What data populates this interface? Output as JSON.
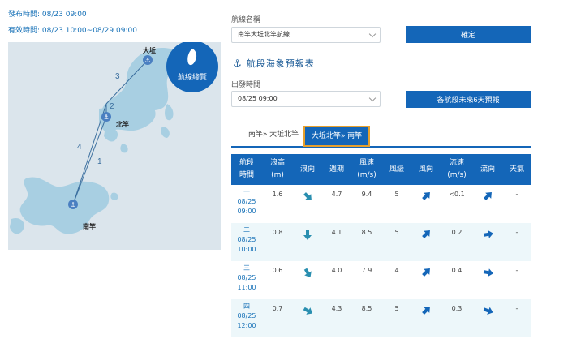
{
  "header": {
    "publish_label": "發布時間:",
    "publish_time": "08/23 09:00",
    "valid_label": "有效時間:",
    "valid_time": "08/23 10:00~08/29 09:00"
  },
  "map": {
    "overview_label": "航線總覽",
    "ports": {
      "north": "大坵",
      "mid": "北竿",
      "south": "南竿"
    },
    "route_numbers": [
      "1",
      "2",
      "3",
      "4"
    ]
  },
  "form": {
    "route_label": "航線名稱",
    "route_value": "南竿大坵北竿航線",
    "confirm_label": "確定",
    "section_title": "航段海象預報表",
    "depart_label": "出發時間",
    "depart_value": "08/25 09:00",
    "six_day_label": "各航段未來6天預報"
  },
  "tabs": [
    {
      "label": "南竿» 大坵北竿",
      "active": false
    },
    {
      "label": "大坵北竿» 南竿",
      "active": true
    }
  ],
  "table": {
    "headers": [
      [
        "航段",
        "時間"
      ],
      [
        "浪高",
        "(m)"
      ],
      [
        "浪向"
      ],
      [
        "週期"
      ],
      [
        "風速",
        "(m/s)"
      ],
      [
        "風級"
      ],
      [
        "風向"
      ],
      [
        "流速",
        "(m/s)"
      ],
      [
        "流向"
      ],
      [
        "天氣"
      ]
    ],
    "rows": [
      {
        "segment": "一",
        "date": "08/25",
        "time": "09:00",
        "wave_height": "1.6",
        "wave_dir_deg": 135,
        "period": "4.7",
        "wind_speed": "9.4",
        "wind_level": "5",
        "wind_dir_deg": 45,
        "current_speed": "<0.1",
        "current_dir_deg": 45,
        "weather": "-"
      },
      {
        "segment": "二",
        "date": "08/25",
        "time": "10:00",
        "wave_height": "0.8",
        "wave_dir_deg": 180,
        "period": "4.1",
        "wind_speed": "8.5",
        "wind_level": "5",
        "wind_dir_deg": 45,
        "current_speed": "0.2",
        "current_dir_deg": 80,
        "weather": "-"
      },
      {
        "segment": "三",
        "date": "08/25",
        "time": "11:00",
        "wave_height": "0.6",
        "wave_dir_deg": 150,
        "period": "4.0",
        "wind_speed": "7.9",
        "wind_level": "4",
        "wind_dir_deg": 45,
        "current_speed": "0.4",
        "current_dir_deg": 100,
        "weather": "-"
      },
      {
        "segment": "四",
        "date": "08/25",
        "time": "12:00",
        "wave_height": "0.7",
        "wave_dir_deg": 120,
        "period": "4.3",
        "wind_speed": "8.5",
        "wind_level": "5",
        "wind_dir_deg": 45,
        "current_speed": "0.3",
        "current_dir_deg": 110,
        "weather": "-"
      }
    ]
  },
  "colors": {
    "accent": "#1466b8",
    "arrow_wave": "#2a8fb0",
    "arrow_wind": "#1466b8",
    "land": "#a8cfe2",
    "sea": "#dbe5ec",
    "tab_active_border": "#e6a02e"
  }
}
